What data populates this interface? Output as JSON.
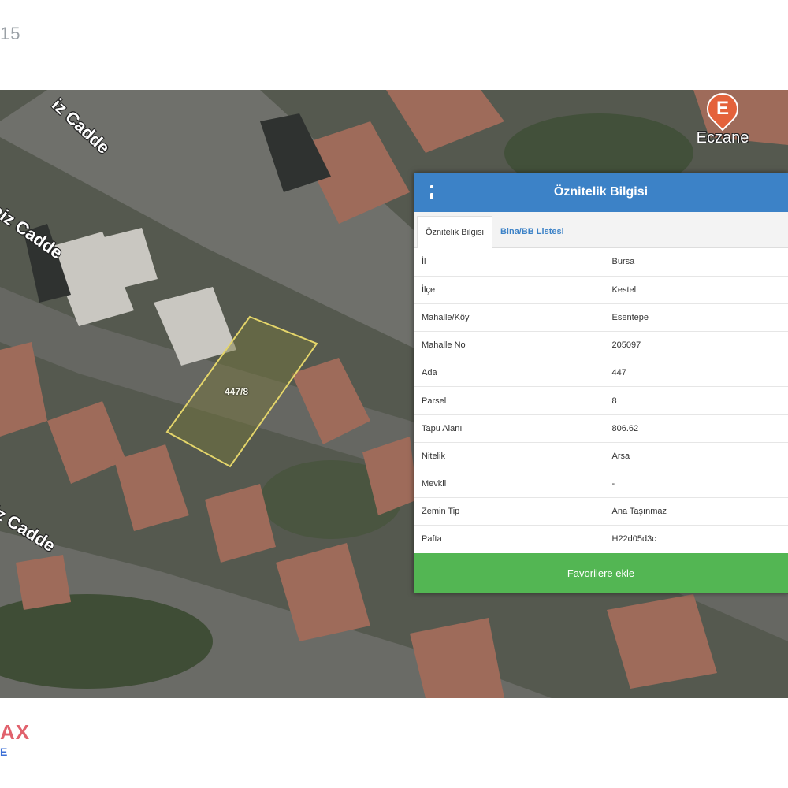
{
  "corner_number": "15",
  "map": {
    "street_labels": [
      "iz Cadde",
      "aiz Cadde",
      "iz Cadde"
    ],
    "poi": {
      "letter": "E",
      "label": "Eczane",
      "icon": "pharmacy-pin-icon"
    },
    "parcel_label": "447/8",
    "colors": {
      "parcel_outline": "#e4d56a",
      "pin": "#e4623b"
    }
  },
  "panel": {
    "title": "Öznitelik Bilgisi",
    "menu_icon": "more-vertical-icon",
    "tabs": [
      {
        "label": "Öznitelik Bilgisi",
        "active": true
      },
      {
        "label": "Bina/BB Listesi",
        "active": false
      }
    ],
    "rows": [
      {
        "key": "İl",
        "value": "Bursa"
      },
      {
        "key": "İlçe",
        "value": "Kestel"
      },
      {
        "key": "Mahalle/Köy",
        "value": "Esentepe"
      },
      {
        "key": "Mahalle No",
        "value": "205097"
      },
      {
        "key": "Ada",
        "value": "447"
      },
      {
        "key": "Parsel",
        "value": "8"
      },
      {
        "key": "Tapu Alanı",
        "value": "806.62"
      },
      {
        "key": "Nitelik",
        "value": "Arsa"
      },
      {
        "key": "Mevkii",
        "value": "-"
      },
      {
        "key": "Zemin Tip",
        "value": "Ana Taşınmaz"
      },
      {
        "key": "Pafta",
        "value": "H22d05d3c"
      }
    ],
    "favorite_button": "Favorilere ekle",
    "colors": {
      "header": "#3c82c7",
      "button": "#53b653"
    }
  },
  "brand": {
    "text": "AX",
    "sub": "E"
  }
}
